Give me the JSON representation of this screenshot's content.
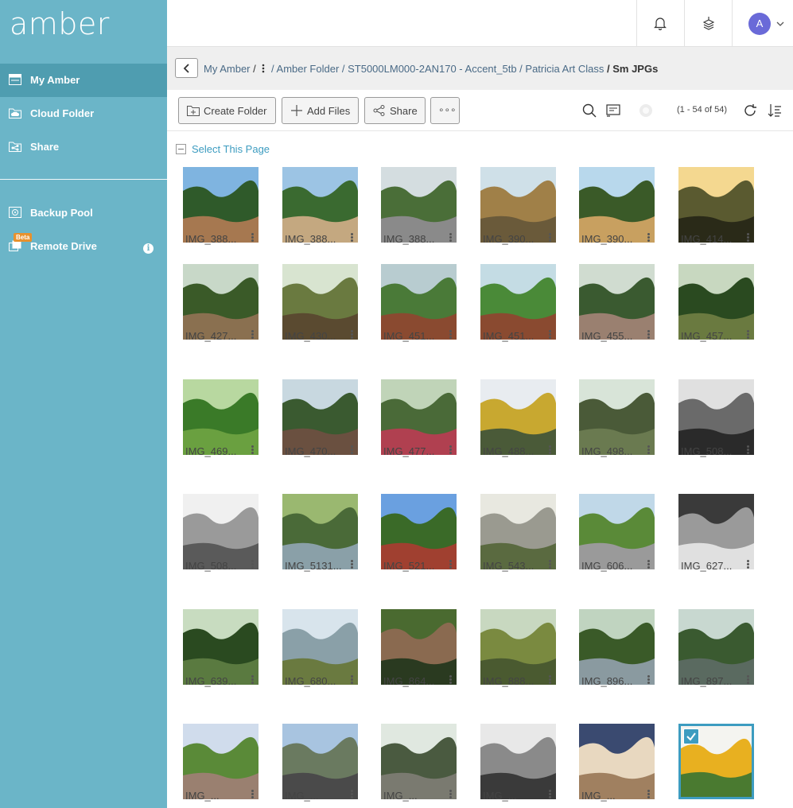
{
  "brand": {
    "logo_text": "amber"
  },
  "sidebar": {
    "items": [
      {
        "label": "My Amber",
        "icon": "drive-icon",
        "active": true
      },
      {
        "label": "Cloud Folder",
        "icon": "cloud-folder-icon",
        "active": false
      },
      {
        "label": "Share",
        "icon": "share-folder-icon",
        "active": false
      },
      {
        "label": "Backup Pool",
        "icon": "backup-icon",
        "active": false
      },
      {
        "label": "Remote Drive",
        "icon": "remote-drive-icon",
        "active": false,
        "badge": "Beta",
        "info_icon": "info-icon"
      }
    ]
  },
  "header": {
    "avatar_initial": "A",
    "icons": [
      "bell-icon",
      "stack-icon",
      "chevron-down-icon"
    ]
  },
  "breadcrumb": {
    "root": "My Amber",
    "root_sep": "/",
    "more_icon": "vertical-ellipsis-icon",
    "path": "/ Amber Folder / ST5000LM000-2AN170 - Accent_5tb / Patricia Art Class",
    "current": "/ Sm JPGs"
  },
  "toolbar": {
    "create_folder": "Create Folder",
    "add_files": "Add Files",
    "share": "Share",
    "more": "∘∘∘",
    "page_count": "(1 - 54 of 54)",
    "icons": [
      "search-icon",
      "cast-icon",
      "loading-icon",
      "refresh-icon",
      "sort-icon"
    ]
  },
  "select_page": {
    "label": "Select This Page"
  },
  "files": [
    {
      "name": "IMG_388...",
      "palette": [
        "#7fb4e0",
        "#2f5a2a",
        "#a67850"
      ]
    },
    {
      "name": "IMG_388...",
      "palette": [
        "#9cc4e4",
        "#3a6a30",
        "#c4a880"
      ]
    },
    {
      "name": "IMG_388...",
      "palette": [
        "#d4dde0",
        "#4a6e38",
        "#8a8a8a"
      ]
    },
    {
      "name": "IMG_390...",
      "palette": [
        "#cfe0e8",
        "#a08048",
        "#6a5a3a"
      ]
    },
    {
      "name": "IMG_390...",
      "palette": [
        "#b8d8ec",
        "#3a5a28",
        "#c8a060"
      ]
    },
    {
      "name": "IMG_414...",
      "palette": [
        "#f4d890",
        "#5a5a30",
        "#2a2a18"
      ]
    },
    {
      "name": "IMG_427...",
      "palette": [
        "#c8d8c8",
        "#3a5a28",
        "#8a7050"
      ]
    },
    {
      "name": "IMG_430...",
      "palette": [
        "#d8e4d0",
        "#6a7a40",
        "#5a4a30"
      ]
    },
    {
      "name": "IMG_451...",
      "palette": [
        "#b8ccd0",
        "#4a7a38",
        "#8a4a30"
      ]
    },
    {
      "name": "IMG_451...",
      "palette": [
        "#c4dce4",
        "#4a8a38",
        "#8a4a30"
      ]
    },
    {
      "name": "IMG_455...",
      "palette": [
        "#d0dcd0",
        "#3a5a30",
        "#9a8070"
      ]
    },
    {
      "name": "IMG_457...",
      "palette": [
        "#c8d8c0",
        "#2a4a20",
        "#6a7a40"
      ]
    },
    {
      "name": "IMG_469...",
      "palette": [
        "#b8d8a0",
        "#3a7a28",
        "#6aa040"
      ]
    },
    {
      "name": "IMG_470...",
      "palette": [
        "#c8d8e0",
        "#3a5a30",
        "#6a5040"
      ]
    },
    {
      "name": "IMG_477...",
      "palette": [
        "#c0d4b8",
        "#4a6a38",
        "#b04050"
      ]
    },
    {
      "name": "IMG_488...",
      "palette": [
        "#e8ecf0",
        "#c8a830",
        "#4a5a38"
      ]
    },
    {
      "name": "IMG_498...",
      "palette": [
        "#d8e4d8",
        "#4a5a38",
        "#6a7a50"
      ]
    },
    {
      "name": "IMG_508...",
      "palette": [
        "#e0e0e0",
        "#6a6a6a",
        "#2a2a2a"
      ]
    },
    {
      "name": "IMG_508...",
      "palette": [
        "#f0f0f0",
        "#9a9a9a",
        "#5a5a5a"
      ]
    },
    {
      "name": "IMG_5131...",
      "palette": [
        "#9ab870",
        "#4a6a38",
        "#8aa0a8"
      ]
    },
    {
      "name": "IMG_521...",
      "palette": [
        "#6aa0e0",
        "#3a6a28",
        "#a04030"
      ]
    },
    {
      "name": "IMG_543...",
      "palette": [
        "#e8e8e0",
        "#9a9a90",
        "#5a6a40"
      ]
    },
    {
      "name": "IMG_606...",
      "palette": [
        "#c0d8e8",
        "#5a8a38",
        "#9a9a9a"
      ]
    },
    {
      "name": "IMG_627...",
      "palette": [
        "#3a3a3a",
        "#9a9a9a",
        "#e0e0e0"
      ]
    },
    {
      "name": "IMG_639...",
      "palette": [
        "#c8dcc0",
        "#2a4a20",
        "#5a7a40"
      ]
    },
    {
      "name": "IMG_680...",
      "palette": [
        "#d8e4ec",
        "#8aa0a8",
        "#6a7a40"
      ]
    },
    {
      "name": "IMG_864...",
      "palette": [
        "#4a6a30",
        "#8a6a50",
        "#2a3a20"
      ]
    },
    {
      "name": "IMG_888...",
      "palette": [
        "#c8d8c0",
        "#7a8a40",
        "#4a5a30"
      ]
    },
    {
      "name": "IMG_896...",
      "palette": [
        "#c0d4c0",
        "#3a5a28",
        "#8a9aa0"
      ]
    },
    {
      "name": "IMG_897...",
      "palette": [
        "#c8d8d0",
        "#3a5a30",
        "#5a6a60"
      ]
    },
    {
      "name": "IMG_...",
      "palette": [
        "#d0dcec",
        "#5a8a38",
        "#9a8070"
      ]
    },
    {
      "name": "IMG_...",
      "palette": [
        "#a8c4e0",
        "#6a7a60",
        "#4a4a4a"
      ]
    },
    {
      "name": "IMG_...",
      "palette": [
        "#e0e8e0",
        "#4a5a40",
        "#7a7a70"
      ]
    },
    {
      "name": "IMG_...",
      "palette": [
        "#e8e8e8",
        "#8a8a8a",
        "#3a3a3a"
      ]
    },
    {
      "name": "IMG_...",
      "palette": [
        "#3a4a70",
        "#e8d8c0",
        "#a08060"
      ]
    },
    {
      "name": "IMG_...",
      "palette": [
        "#f4f4f0",
        "#e8b020",
        "#4a7a30"
      ],
      "selected": true
    }
  ],
  "colors": {
    "sidebar": "#6bb5c8",
    "sidebar_active": "#4f9db0",
    "accent": "#3d9cc0",
    "beta": "#e8912d",
    "avatar": "#6a6ad8"
  }
}
